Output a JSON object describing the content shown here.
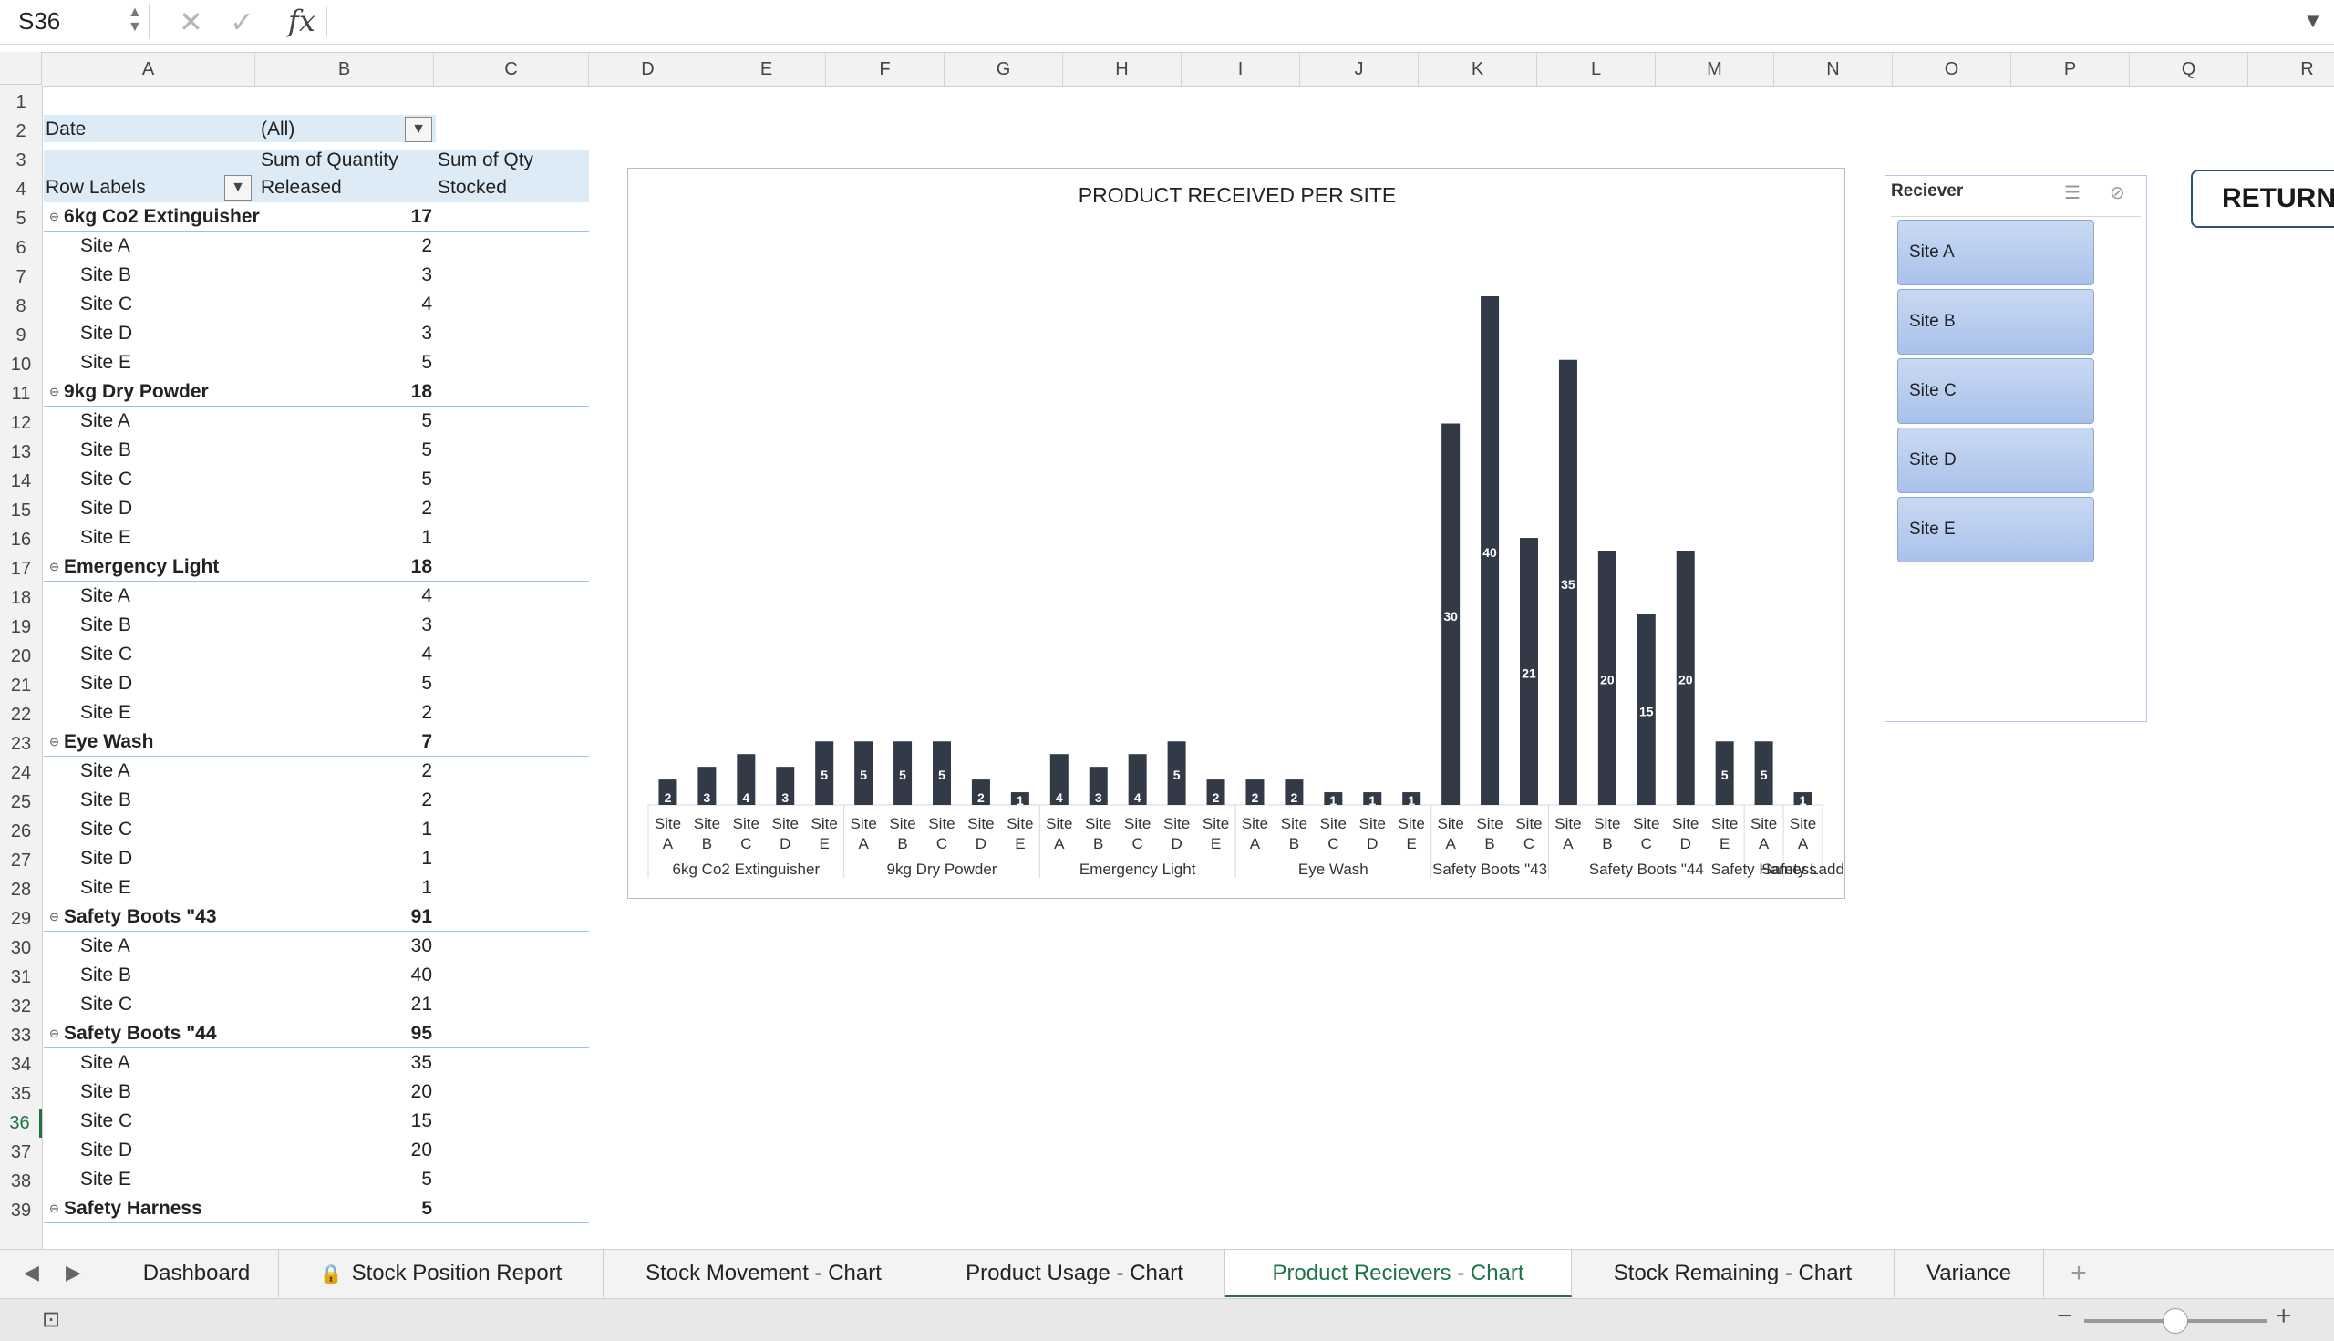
{
  "name_box": "S36",
  "formula_bar": {
    "cancel_icon": "x-icon",
    "enter_icon": "check-icon",
    "fx_label": "fx",
    "formula": ""
  },
  "columns": [
    "A",
    "B",
    "C",
    "D",
    "E",
    "F",
    "G",
    "H",
    "I",
    "J",
    "K",
    "L",
    "M",
    "N",
    "O",
    "P",
    "Q",
    "R"
  ],
  "rows": [
    "1",
    "2",
    "3",
    "4",
    "5",
    "6",
    "7",
    "8",
    "9",
    "10",
    "11",
    "12",
    "13",
    "14",
    "15",
    "16",
    "17",
    "18",
    "19",
    "20",
    "21",
    "22",
    "23",
    "24",
    "25",
    "26",
    "27",
    "28",
    "29",
    "30",
    "31",
    "32",
    "33",
    "34",
    "35",
    "36",
    "37",
    "38",
    "39"
  ],
  "selected_row": "36",
  "pivot": {
    "filter_label": "Date",
    "filter_value": "(All)",
    "row_labels": "Row Labels",
    "col_qty_released_1": "Sum of Quantity",
    "col_qty_released_2": "Released",
    "col_qty_stocked_1": "Sum of Qty",
    "col_qty_stocked_2": "Stocked",
    "rows": [
      {
        "label": "6kg Co2 Extinguisher",
        "value": "17",
        "group": true
      },
      {
        "label": "Site A",
        "value": "2"
      },
      {
        "label": "Site B",
        "value": "3"
      },
      {
        "label": "Site C",
        "value": "4"
      },
      {
        "label": "Site D",
        "value": "3"
      },
      {
        "label": "Site E",
        "value": "5"
      },
      {
        "label": "9kg Dry Powder",
        "value": "18",
        "group": true
      },
      {
        "label": "Site A",
        "value": "5"
      },
      {
        "label": "Site B",
        "value": "5"
      },
      {
        "label": "Site C",
        "value": "5"
      },
      {
        "label": "Site D",
        "value": "2"
      },
      {
        "label": "Site E",
        "value": "1"
      },
      {
        "label": "Emergency Light",
        "value": "18",
        "group": true
      },
      {
        "label": "Site A",
        "value": "4"
      },
      {
        "label": "Site B",
        "value": "3"
      },
      {
        "label": "Site C",
        "value": "4"
      },
      {
        "label": "Site D",
        "value": "5"
      },
      {
        "label": "Site E",
        "value": "2"
      },
      {
        "label": "Eye Wash",
        "value": "7",
        "group": true
      },
      {
        "label": "Site A",
        "value": "2"
      },
      {
        "label": "Site B",
        "value": "2"
      },
      {
        "label": "Site C",
        "value": "1"
      },
      {
        "label": "Site D",
        "value": "1"
      },
      {
        "label": "Site E",
        "value": "1"
      },
      {
        "label": "Safety Boots \"43",
        "value": "91",
        "group": true
      },
      {
        "label": "Site A",
        "value": "30"
      },
      {
        "label": "Site B",
        "value": "40"
      },
      {
        "label": "Site C",
        "value": "21"
      },
      {
        "label": "Safety Boots \"44",
        "value": "95",
        "group": true
      },
      {
        "label": "Site A",
        "value": "35"
      },
      {
        "label": "Site B",
        "value": "20"
      },
      {
        "label": "Site C",
        "value": "15"
      },
      {
        "label": "Site D",
        "value": "20"
      },
      {
        "label": "Site E",
        "value": "5"
      },
      {
        "label": "Safety Harness",
        "value": "5",
        "group": true
      }
    ]
  },
  "chart_data": {
    "type": "bar",
    "title": "PRODUCT RECEIVED PER SITE",
    "bar_color": "#323a47",
    "groups": [
      {
        "name": "6kg Co2 Extinguisher",
        "sites": [
          "Site A",
          "Site B",
          "Site C",
          "Site D",
          "Site E"
        ],
        "values": [
          2,
          3,
          4,
          3,
          5
        ]
      },
      {
        "name": "9kg Dry Powder",
        "sites": [
          "Site A",
          "Site B",
          "Site C",
          "Site D",
          "Site E"
        ],
        "values": [
          5,
          5,
          5,
          2,
          1
        ]
      },
      {
        "name": "Emergency Light",
        "sites": [
          "Site A",
          "Site B",
          "Site C",
          "Site D",
          "Site E"
        ],
        "values": [
          4,
          3,
          4,
          5,
          2
        ]
      },
      {
        "name": "Eye Wash",
        "sites": [
          "Site A",
          "Site B",
          "Site C",
          "Site D",
          "Site E"
        ],
        "values": [
          2,
          2,
          1,
          1,
          1
        ]
      },
      {
        "name": "Safety Boots \"43",
        "sites": [
          "Site A",
          "Site B",
          "Site C"
        ],
        "values": [
          30,
          40,
          21
        ]
      },
      {
        "name": "Safety Boots \"44",
        "sites": [
          "Site A",
          "Site B",
          "Site C",
          "Site D",
          "Site E"
        ],
        "values": [
          35,
          20,
          15,
          20,
          5
        ]
      },
      {
        "name": "Safety Harness",
        "sites": [
          "Site A"
        ],
        "values": [
          5
        ]
      },
      {
        "name": "Safety Ladd",
        "sites": [
          "Site A"
        ],
        "values": [
          1
        ]
      }
    ],
    "ylim": [
      0,
      40
    ]
  },
  "slicer": {
    "title": "Reciever",
    "multiselect_icon": "multi-select-icon",
    "clear_icon": "clear-filter-icon",
    "items": [
      "Site A",
      "Site B",
      "Site C",
      "Site D",
      "Site E"
    ]
  },
  "return_button": "RETURN",
  "tabs": [
    {
      "label": "Dashboard",
      "active": false
    },
    {
      "label": "Stock Position Report",
      "active": false,
      "locked": true
    },
    {
      "label": "Stock Movement - Chart",
      "active": false
    },
    {
      "label": "Product Usage - Chart",
      "active": false
    },
    {
      "label": "Product Recievers - Chart",
      "active": true
    },
    {
      "label": "Stock Remaining - Chart",
      "active": false
    },
    {
      "label": "Variance",
      "active": false
    }
  ],
  "add_sheet": "+",
  "accent_color": "#217346"
}
